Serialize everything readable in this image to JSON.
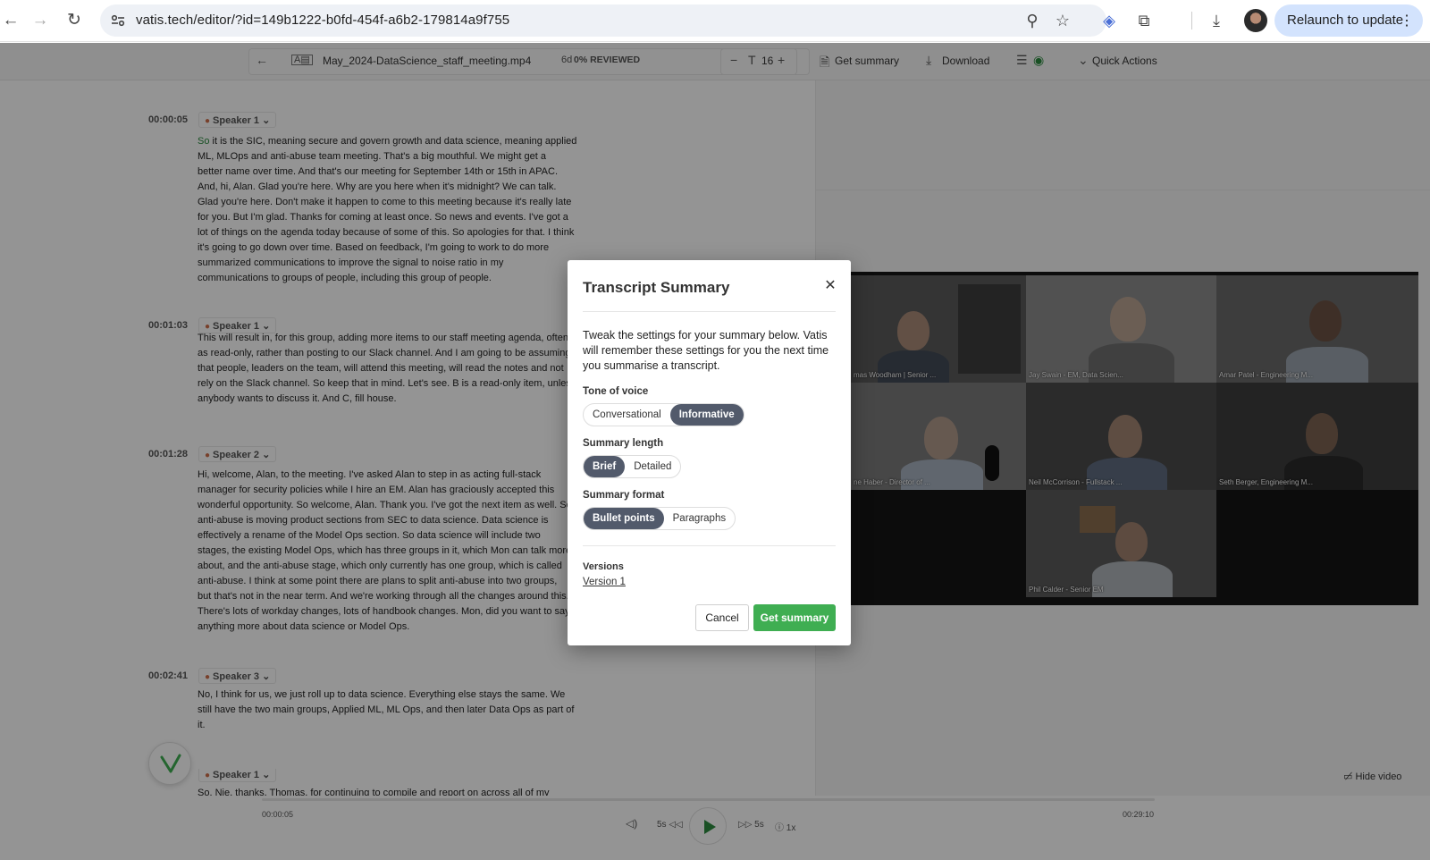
{
  "browser": {
    "url": "vatis.tech/editor/?id=149b1222-b0fd-454f-a6b2-179814a9f755",
    "relaunch_label": "Relaunch to update"
  },
  "toolbar": {
    "filename": "May_2024-DataScience_staff_meeting.mp4",
    "reviewed": "0% REVIEWED",
    "font_size": "16",
    "get_summary": "Get summary",
    "download": "Download",
    "quick_actions": "Quick Actions"
  },
  "transcript": [
    {
      "time": "00:00:05",
      "speaker": "Speaker 1",
      "lead": "So",
      "lines": [
        " it is the SIC, meaning secure and govern growth and data science, meaning applied",
        "ML, MLOps and anti-abuse team meeting. That's a big mouthful. We might get a",
        "better name over time. And that's our meeting for September 14th or 15th in APAC.",
        "And, hi, Alan. Glad you're here. Why are you here when it's midnight? We can talk.",
        "Glad you're here. Don't make it happen to come to this meeting because it's really late",
        "for you. But I'm glad. Thanks for coming at least once. So news and events. I've got a",
        "lot of things on the agenda today because of some of this. So apologies for that. I think",
        "it's going to go down over time. Based on feedback, I'm going to work to do more",
        "summarized communications to improve the signal to noise ratio in my",
        "communications to groups of people, including this group of people."
      ]
    },
    {
      "time": "00:01:03",
      "speaker": "Speaker 1",
      "lines": [
        "This will result in, for this group, adding more items to our staff meeting agenda, often",
        "as read-only, rather than posting to our Slack channel. And I am going to be assuming",
        "that people, leaders on the team, will attend this meeting, will read the notes and not",
        "rely on the Slack channel. So keep that in mind. Let's see. B is a read-only item, unless",
        "anybody wants to discuss it. And C, fill house."
      ]
    },
    {
      "time": "00:01:28",
      "speaker": "Speaker 2",
      "lines": [
        "Hi, welcome, Alan, to the meeting. I've asked Alan to step in as acting full-stack",
        "manager for security policies while I hire an EM. Alan has graciously accepted this",
        "wonderful opportunity. So welcome, Alan. Thank you. I've got the next item as well. So",
        "anti-abuse is moving product sections from SEC to data science. Data science is",
        "effectively a rename of the Model Ops section. So data science will include two",
        "stages, the existing Model Ops, which has three groups in it, which Mon can talk more",
        "about, and the anti-abuse stage, which only currently has one group, which is called",
        "anti-abuse. I think at some point there are plans to split anti-abuse into two groups,",
        "but that's not in the near term. And we're working through all the changes around this.",
        "There's lots of workday changes, lots of handbook changes. Mon, did you want to say",
        "anything more about data science or Model Ops."
      ]
    },
    {
      "time": "00:02:41",
      "speaker": "Speaker 3",
      "lines": [
        "No, I think for us, we just roll up to data science. Everything else stays the same. We",
        "still have the two main groups, Applied ML, ML Ops, and then later Data Ops as part of",
        "it."
      ]
    },
    {
      "time": "",
      "speaker": "Speaker 1",
      "lines": [
        "So. Nie, thanks, Thomas, for continuing to compile and report on across all of my"
      ]
    }
  ],
  "video": {
    "tiles": [
      {
        "caption": "mas Woodham | Senior ..."
      },
      {
        "caption": "Jay Swain - EM, Data Scien..."
      },
      {
        "caption": "Amar Patel - Engineering M..."
      },
      {
        "caption": "ne Haber - Director of ..."
      },
      {
        "caption": "Neil McCorrison - Fullstack ..."
      },
      {
        "caption": "Seth Berger, Engineering M..."
      },
      {
        "caption": "Phil Calder - Senior EM"
      }
    ],
    "hide_label": "Hide video"
  },
  "player": {
    "current": "00:00:05",
    "total": "00:29:10",
    "rewind": "5s",
    "forward": "5s",
    "speed": "1x"
  },
  "modal": {
    "title": "Transcript Summary",
    "description": "Tweak the settings for your summary below. Vatis will remember these settings for you the next time you summarise a transcript.",
    "tone_label": "Tone of voice",
    "tone_options": [
      "Conversational",
      "Informative"
    ],
    "tone_selected": "Informative",
    "length_label": "Summary length",
    "length_options": [
      "Brief",
      "Detailed"
    ],
    "length_selected": "Brief",
    "format_label": "Summary format",
    "format_options": [
      "Bullet points",
      "Paragraphs"
    ],
    "format_selected": "Bullet points",
    "versions_label": "Versions",
    "version_link": "Version 1",
    "cancel": "Cancel",
    "submit": "Get summary"
  }
}
